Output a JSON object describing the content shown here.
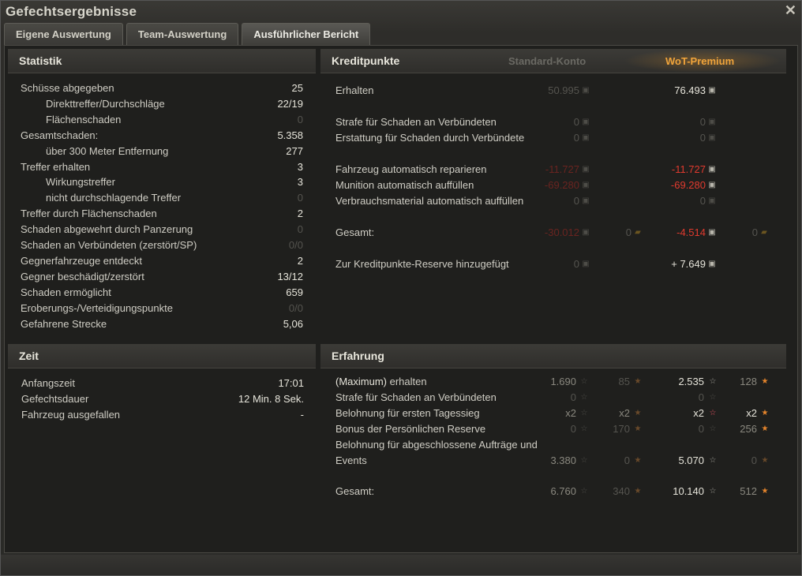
{
  "window": {
    "title": "Gefechtsergebnisse",
    "close": "✕"
  },
  "tabs": [
    {
      "label": "Eigene Auswertung"
    },
    {
      "label": "Team-Auswertung"
    },
    {
      "label": "Ausführlicher Bericht",
      "active": true
    }
  ],
  "statistik": {
    "title": "Statistik",
    "rows": [
      {
        "label": "Schüsse abgegeben",
        "value": "25"
      },
      {
        "label": "Direkttreffer/Durchschläge",
        "value": "22/19"
      },
      {
        "label": "Flächenschaden",
        "value": "0"
      },
      {
        "label": "Gesamtschaden:",
        "value": "5.358"
      },
      {
        "label": "über 300 Meter Entfernung",
        "value": "277"
      },
      {
        "label": "Treffer erhalten",
        "value": "3"
      },
      {
        "label": "Wirkungstreffer",
        "value": "3"
      },
      {
        "label": "nicht durchschlagende Treffer",
        "value": "0"
      },
      {
        "label": "Treffer durch Flächenschaden",
        "value": "2"
      },
      {
        "label": "Schaden abgewehrt durch Panzerung",
        "value": "0"
      },
      {
        "label": "Schaden an Verbündeten (zerstört/SP)",
        "value": "0/0"
      },
      {
        "label": "Gegnerfahrzeuge entdeckt",
        "value": "2"
      },
      {
        "label": "Gegner beschädigt/zerstört",
        "value": "13/12"
      },
      {
        "label": "Schaden ermöglicht",
        "value": "659"
      },
      {
        "label": "Eroberungs-/Verteidigungspunkte",
        "value": "0/0"
      },
      {
        "label": "Gefahrene Strecke",
        "value": "5,06"
      }
    ]
  },
  "zeit": {
    "title": "Zeit",
    "rows": [
      {
        "label": "Anfangszeit",
        "value": "17:01"
      },
      {
        "label": "Gefechtsdauer",
        "value": "12 Min. 8 Sek."
      },
      {
        "label": "Fahrzeug ausgefallen",
        "value": "-"
      }
    ]
  },
  "kredit": {
    "title": "Kreditpunkte",
    "col_standard": "Standard-Konto",
    "col_premium": "WoT-Premium",
    "rows": [
      {
        "label": "Erhalten",
        "std": "50.995",
        "prem": "76.493"
      },
      {
        "label": "Strafe für Schaden an Verbündeten",
        "std": "0",
        "prem": "0"
      },
      {
        "label": "Erstattung für Schaden durch Verbündete",
        "std": "0",
        "prem": "0"
      },
      {
        "label": "Fahrzeug automatisch reparieren",
        "std": "-11.727",
        "prem": "-11.727"
      },
      {
        "label": "Munition automatisch auffüllen",
        "std": "-69.280",
        "prem": "-69.280"
      },
      {
        "label": "Verbrauchsmaterial automatisch auffüllen",
        "std": "0",
        "prem": "0"
      },
      {
        "label": "Gesamt:",
        "std": "-30.012",
        "std_gold": "0",
        "prem": "-4.514",
        "prem_gold": "0"
      },
      {
        "label": "Zur Kreditpunkte-Reserve hinzugefügt",
        "std": "0",
        "prem": "+ 7.649"
      }
    ]
  },
  "erfahrung": {
    "title": "Erfahrung",
    "rows": [
      {
        "label_bold": "(Maximum)",
        "label": " erhalten",
        "std": "1.690",
        "std_free": "85",
        "prem": "2.535",
        "prem_free": "128"
      },
      {
        "label": "Strafe für Schaden an Verbündeten",
        "std": "0",
        "prem": "0"
      },
      {
        "label": "Belohnung für ersten Tagessieg",
        "std": "x2",
        "std_free": "x2",
        "prem": "x2",
        "prem_free": "x2"
      },
      {
        "label": "Bonus der Persönlichen Reserve",
        "std": "0",
        "std_free": "170",
        "prem": "0",
        "prem_free": "256"
      },
      {
        "label": "Belohnung für abgeschlossene Aufträge und",
        "label2": "Events",
        "std": "3.380",
        "std_free": "0",
        "prem": "5.070",
        "prem_free": "0"
      },
      {
        "label": "Gesamt:",
        "std": "6.760",
        "std_free": "340",
        "prem": "10.140",
        "prem_free": "512"
      }
    ]
  }
}
